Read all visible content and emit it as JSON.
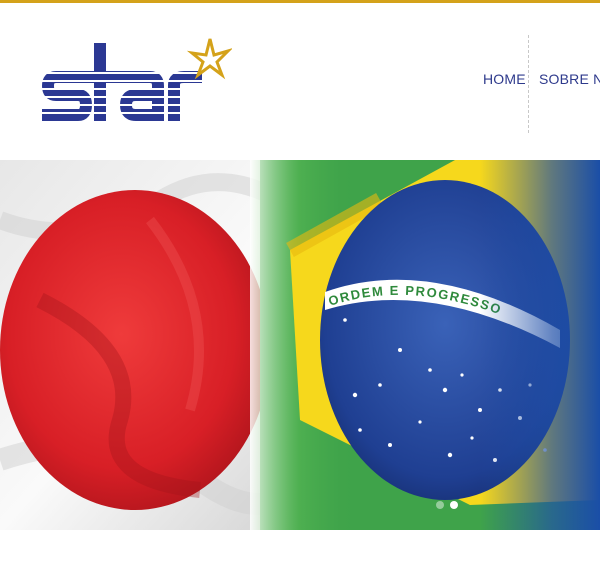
{
  "brand": {
    "logo_text": "star",
    "colors": {
      "navy": "#2b3893",
      "gold": "#d4a21a"
    }
  },
  "nav": {
    "home_label": "HOME",
    "sobre_label": "SOBRE NÓS"
  },
  "hero": {
    "banner_text": "ORDEM E PROGRESSO",
    "slides": [
      {
        "active": false
      },
      {
        "active": true
      }
    ]
  },
  "icons": {
    "logo_star": "star-icon"
  }
}
